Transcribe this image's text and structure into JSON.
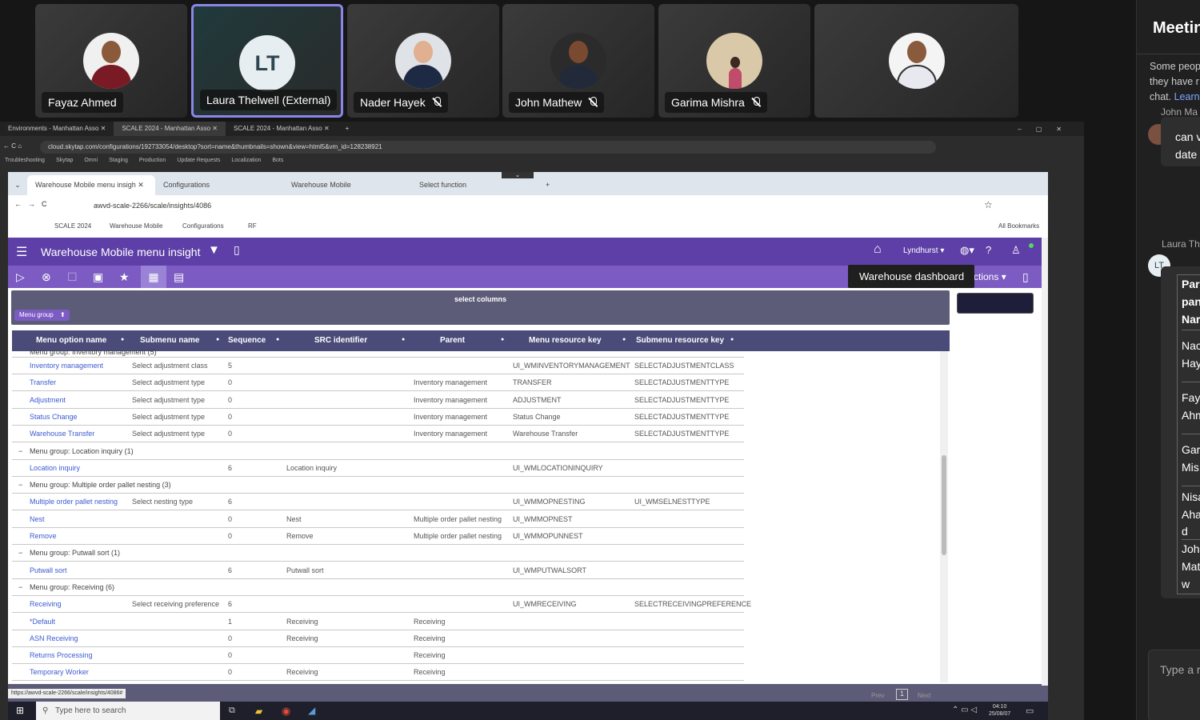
{
  "meeting": {
    "participants": [
      {
        "name": "Fayaz Ahmed",
        "muted": false
      },
      {
        "name": "Laura Thelwell (External)",
        "initials": "LT",
        "muted": false
      },
      {
        "name": "Nader Hayek",
        "muted": true
      },
      {
        "name": "John Mathew",
        "muted": true
      },
      {
        "name": "Garima Mishra",
        "muted": true
      },
      {
        "name": "",
        "muted": false
      }
    ],
    "panel": {
      "title": "Meetin",
      "notice": [
        "Some peop",
        "they have r",
        "chat."
      ],
      "notice_link": "Learn",
      "msg1_author": "John Ma",
      "msg1_text": [
        "can v",
        "date"
      ],
      "msg2_author": "Laura Th",
      "msg2_initials": "LT",
      "table": [
        "Par",
        "pan",
        "Nar",
        "Nac",
        "Hay",
        "Faya",
        "Ahm",
        "Gari",
        "Mis",
        "Nisa",
        "Aha",
        "d",
        "John",
        "Mat",
        "w"
      ],
      "input_placeholder": "Type a r"
    }
  },
  "outer_browser": {
    "tabs": [
      "Environments - Manhattan Asso",
      "SCALE 2024 - Manhattan Asso",
      "SCALE 2024 - Manhattan Asso"
    ],
    "url": "cloud.skytap.com/configurations/192733054/desktop?sort=name&thumbnails=shown&view=html5&vm_id=128238921",
    "bookmarks": [
      "Troubleshooting",
      "Skytap",
      "Omni",
      "Staging",
      "Production",
      "Update Requests",
      "Localization",
      "Bots"
    ]
  },
  "inner_browser": {
    "tabs": [
      "Warehouse Mobile menu insigh",
      "Configurations",
      "Warehouse Mobile",
      "Select function"
    ],
    "url": "awvd-scale-2266/scale/insights/4086",
    "bookmarks": [
      "SCALE 2024",
      "Warehouse Mobile",
      "Configurations",
      "RF"
    ],
    "all_bookmarks": "All Bookmarks"
  },
  "app": {
    "title": "Warehouse Mobile menu insight",
    "facility": "Lyndhurst",
    "tooltip": "Warehouse dashboard",
    "actions": "ctions",
    "select_columns": "select columns",
    "group_chip": "Menu group",
    "columns": [
      "Menu option name",
      "Submenu name",
      "Sequence",
      "SRC identifier",
      "Parent",
      "Menu resource key",
      "Submenu resource key"
    ],
    "partial_group": "Menu group: Inventory management (5)",
    "rows": [
      {
        "t": "r",
        "c": [
          "Inventory management",
          "Select adjustment class",
          "5",
          "",
          "",
          "UI_WMINVENTORYMANAGEMENT",
          "SELECTADJUSTMENTCLASS"
        ]
      },
      {
        "t": "r",
        "c": [
          "Transfer",
          "Select adjustment type",
          "0",
          "",
          "Inventory management",
          "TRANSFER",
          "SELECTADJUSTMENTTYPE"
        ]
      },
      {
        "t": "r",
        "c": [
          "Adjustment",
          "Select adjustment type",
          "0",
          "",
          "Inventory management",
          "ADJUSTMENT",
          "SELECTADJUSTMENTTYPE"
        ]
      },
      {
        "t": "r",
        "c": [
          "Status Change",
          "Select adjustment type",
          "0",
          "",
          "Inventory management",
          "Status Change",
          "SELECTADJUSTMENTTYPE"
        ]
      },
      {
        "t": "r",
        "c": [
          "Warehouse Transfer",
          "Select adjustment type",
          "0",
          "",
          "Inventory management",
          "Warehouse Transfer",
          "SELECTADJUSTMENTTYPE"
        ]
      },
      {
        "t": "g",
        "c": [
          "Menu group: Location inquiry (1)"
        ]
      },
      {
        "t": "r",
        "c": [
          "Location inquiry",
          "",
          "6",
          "Location inquiry",
          "",
          "UI_WMLOCATIONINQUIRY",
          ""
        ]
      },
      {
        "t": "g",
        "c": [
          "Menu group: Multiple order pallet nesting (3)"
        ]
      },
      {
        "t": "r",
        "c": [
          "Multiple order pallet nesting",
          "Select nesting type",
          "6",
          "",
          "",
          "UI_WMMOPNESTING",
          "UI_WMSELNESTTYPE"
        ]
      },
      {
        "t": "r",
        "c": [
          "Nest",
          "",
          "0",
          "Nest",
          "Multiple order pallet nesting",
          "UI_WMMOPNEST",
          ""
        ]
      },
      {
        "t": "r",
        "c": [
          "Remove",
          "",
          "0",
          "Remove",
          "Multiple order pallet nesting",
          "UI_WMMOPUNNEST",
          ""
        ]
      },
      {
        "t": "g",
        "c": [
          "Menu group: Putwall sort (1)"
        ]
      },
      {
        "t": "r",
        "c": [
          "Putwall sort",
          "",
          "6",
          "Putwall sort",
          "",
          "UI_WMPUTWALSORT",
          ""
        ]
      },
      {
        "t": "g",
        "c": [
          "Menu group: Receiving (6)"
        ]
      },
      {
        "t": "r",
        "c": [
          "Receiving",
          "Select receiving preference",
          "6",
          "",
          "",
          "UI_WMRECEIVING",
          "SELECTRECEIVINGPREFERENCE"
        ]
      },
      {
        "t": "r",
        "c": [
          "*Default",
          "",
          "1",
          "Receiving",
          "Receiving",
          "",
          ""
        ]
      },
      {
        "t": "r",
        "c": [
          "ASN Receiving",
          "",
          "0",
          "Receiving",
          "Receiving",
          "",
          ""
        ]
      },
      {
        "t": "r",
        "c": [
          "Returns Processing",
          "",
          "0",
          "",
          "Receiving",
          "",
          ""
        ]
      },
      {
        "t": "r",
        "c": [
          "Temporary Worker",
          "",
          "0",
          "Receiving",
          "Receiving",
          "",
          ""
        ]
      }
    ],
    "pager_prev": "Prev",
    "pager_page": "1",
    "pager_next": "Next",
    "status_url": "https://awvd-scale-2266/scale/insights/4086#"
  },
  "taskbar": {
    "search": "Type here to search",
    "time": "04:10",
    "date": "25/08/07"
  },
  "colors": {
    "app_bar": "#5e3fa8",
    "toolbar": "#7c5bc2",
    "header": "#4b4b7a",
    "link": "#3b5bd0",
    "active_tile": "#8a86e8"
  }
}
